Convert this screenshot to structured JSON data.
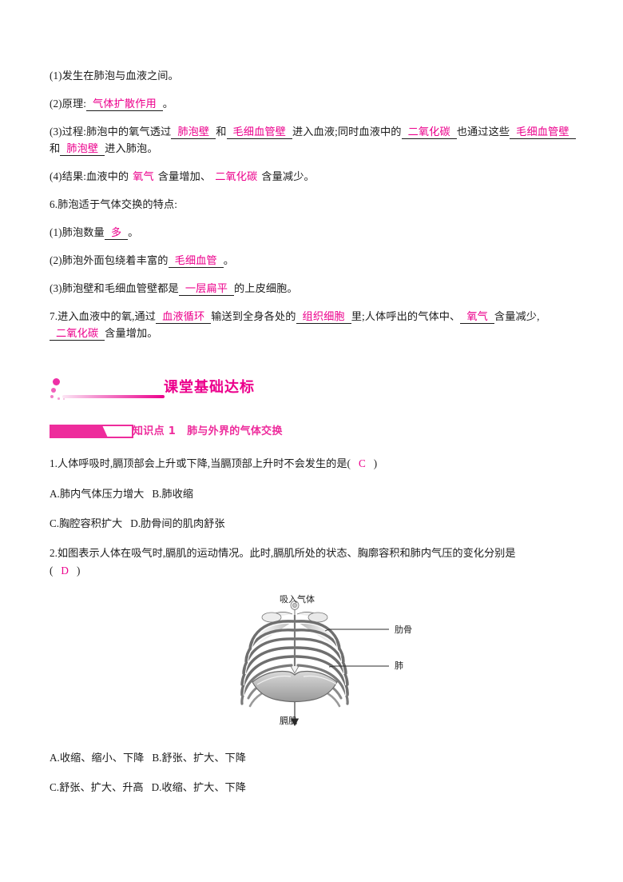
{
  "colors": {
    "accent": "#ec008c",
    "banner": "#ee2c9c",
    "text": "#1c1c1c"
  },
  "notes": {
    "item5": {
      "sub1": {
        "prefix": "(1)发生在肺泡与血液之间。"
      },
      "sub2": {
        "prefix": "(2)原理:",
        "blank1": "气体扩散作用",
        "suffix": "。"
      },
      "sub3": {
        "prefix": "(3)过程:肺泡中的氧气透过",
        "blank1": "肺泡壁",
        "mid1": "和",
        "blank2": "毛细血管壁",
        "mid2": "进入血液;同时血液中的",
        "blank3": "二氧化碳",
        "mid3": "也通过这些",
        "blank4": "毛细血管壁",
        "mid4": "和",
        "blank5": "肺泡壁",
        "suffix": "进入肺泡。"
      },
      "sub4": {
        "prefix": "(4)结果:血液中的",
        "blank1": "氧气",
        "mid1": "含量增加、",
        "blank2": "二氧化碳",
        "suffix": "含量减少。"
      }
    },
    "item6": {
      "heading": "6.肺泡适于气体交换的特点:",
      "sub1": {
        "prefix": "(1)肺泡数量",
        "blank1": "多",
        "suffix": "。"
      },
      "sub2": {
        "prefix": "(2)肺泡外面包绕着丰富的",
        "blank1": "毛细血管",
        "suffix": "。"
      },
      "sub3": {
        "prefix": "(3)肺泡壁和毛细血管壁都是",
        "blank1": "一层扁平",
        "suffix": "的上皮细胞。"
      }
    },
    "item7": {
      "prefix": "7.进入血液中的氧,通过",
      "blank1": "血液循环",
      "mid1": "输送到全身各处的",
      "blank2": "组织细胞",
      "mid2": "里;人体呼出的气体中、",
      "blank3": "氧气",
      "mid3": "含量减少,",
      "blank4": "二氧化碳",
      "suffix": "含量增加。"
    }
  },
  "section": {
    "title": "课堂基础达标"
  },
  "knowledge_point": {
    "number": "知识点 1",
    "title": "肺与外界的气体交换"
  },
  "questions": [
    {
      "stem_before": "1.人体呼吸时,膈顶部会上升或下降,当膈顶部上升时不会发生的是(",
      "answer": "C",
      "stem_after": ")",
      "options_line1": "A.肺内气体压力增大",
      "options_line1b": "B.肺收缩",
      "options_line2": "C.胸腔容积扩大",
      "options_line2b": "D.肋骨间的肌肉舒张"
    },
    {
      "stem_before": "2.如图表示人体在吸气时,膈肌的运动情况。此时,膈肌所处的状态、胸廓容积和肺内气压的变化分别是",
      "bracket_open": "(",
      "answer": "D",
      "bracket_close": ")",
      "options_line1": "A.收缩、缩小、下降",
      "options_line1b": "B.舒张、扩大、下降",
      "options_line2": "C.舒张、扩大、升高",
      "options_line2b": "D.收缩、扩大、下降"
    }
  ],
  "figure": {
    "label_top": "吸入气体",
    "label_rib": "肋骨",
    "label_lung": "肺",
    "label_diaphragm": "膈肌"
  }
}
